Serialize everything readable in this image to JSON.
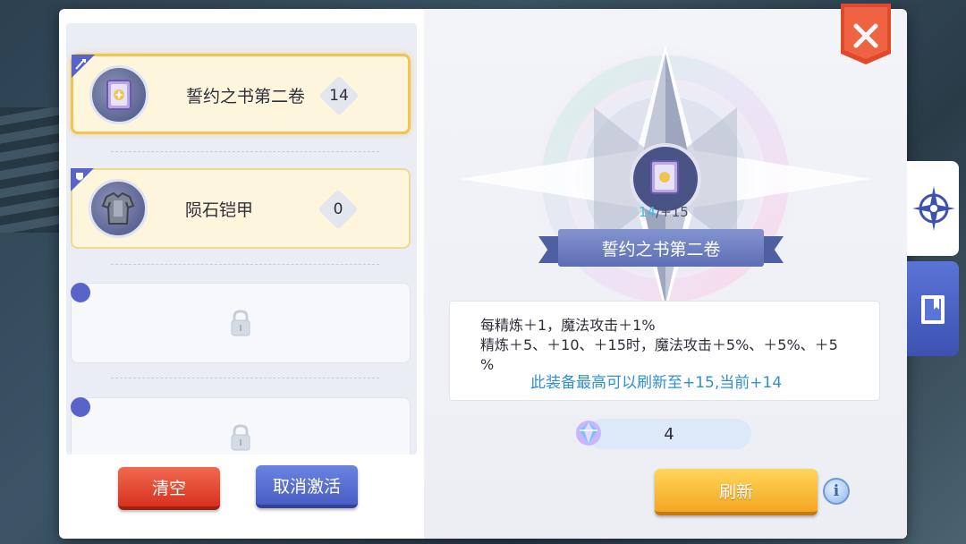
{
  "close_button": {
    "icon": "close-icon"
  },
  "slots": [
    {
      "name": "誓约之书第二卷",
      "level": "14",
      "state": "active",
      "icon": "book-icon",
      "badge_icon": "sword-badge-icon"
    },
    {
      "name": "陨石铠甲",
      "level": "0",
      "state": "normal",
      "icon": "armor-icon",
      "badge_icon": "shield-badge-icon"
    },
    {
      "state": "locked",
      "icon": "lock-icon"
    },
    {
      "state": "locked",
      "icon": "lock-icon"
    }
  ],
  "buttons": {
    "clear_label": "清空",
    "cancel_label": "取消激活",
    "refresh_label": "刷新"
  },
  "selected": {
    "name": "誓约之书第二卷",
    "level_current": "14",
    "level_max": "/+15"
  },
  "description": {
    "line1": "每精炼＋1，魔法攻击＋1%",
    "line2": "精炼＋5、＋10、＋15时，魔法攻击＋5%、＋5%、＋5",
    "line3": "%",
    "highlight": "此装备最高可以刷新至+15,当前+14"
  },
  "cost": {
    "value": "4",
    "icon": "gem-icon"
  },
  "colors": {
    "active_border": "#f0c553",
    "red_button": "#d8321f",
    "blue_button": "#4a5fc6",
    "yellow_button": "#f5a623",
    "highlight_text": "#2f8fd0",
    "level_current": "#3cb9e8"
  },
  "side_tabs": [
    {
      "icon": "compass-icon",
      "state": "active"
    },
    {
      "icon": "book-tab-icon",
      "state": "inactive"
    }
  ]
}
